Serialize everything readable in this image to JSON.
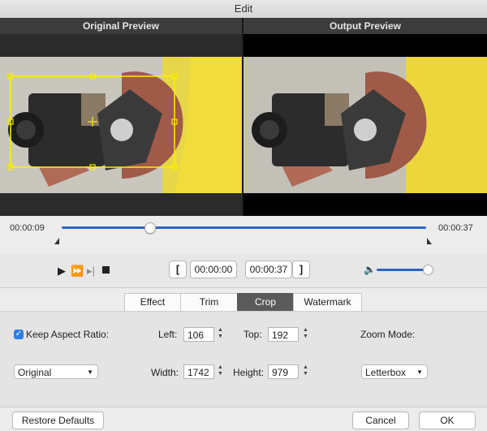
{
  "window": {
    "title": "Edit"
  },
  "preview": {
    "original_label": "Original Preview",
    "output_label": "Output Preview"
  },
  "timeline": {
    "current_time": "00:00:09",
    "total_time": "00:00:37",
    "progress_fraction": 0.24
  },
  "transport": {
    "start_bracket": "[",
    "start_time": "00:00:00",
    "end_time": "00:00:37",
    "end_bracket": "]",
    "volume_fraction": 0.85
  },
  "tabs": [
    {
      "label": "Effect",
      "active": false
    },
    {
      "label": "Trim",
      "active": false
    },
    {
      "label": "Crop",
      "active": true
    },
    {
      "label": "Watermark",
      "active": false
    }
  ],
  "crop": {
    "keep_aspect_label": "Keep Aspect Ratio:",
    "keep_aspect_checked": true,
    "left_label": "Left:",
    "left_value": "106",
    "top_label": "Top:",
    "top_value": "192",
    "zoom_label": "Zoom Mode:",
    "aspect_select": "Original",
    "width_label": "Width:",
    "width_value": "1742",
    "height_label": "Height:",
    "height_value": "979",
    "zoom_select": "Letterbox"
  },
  "footer": {
    "restore_label": "Restore Defaults",
    "cancel_label": "Cancel",
    "ok_label": "OK"
  },
  "colors": {
    "accent": "#2a64c8",
    "crop_box": "#ffee00",
    "active_tab": "#5a5a5a"
  }
}
